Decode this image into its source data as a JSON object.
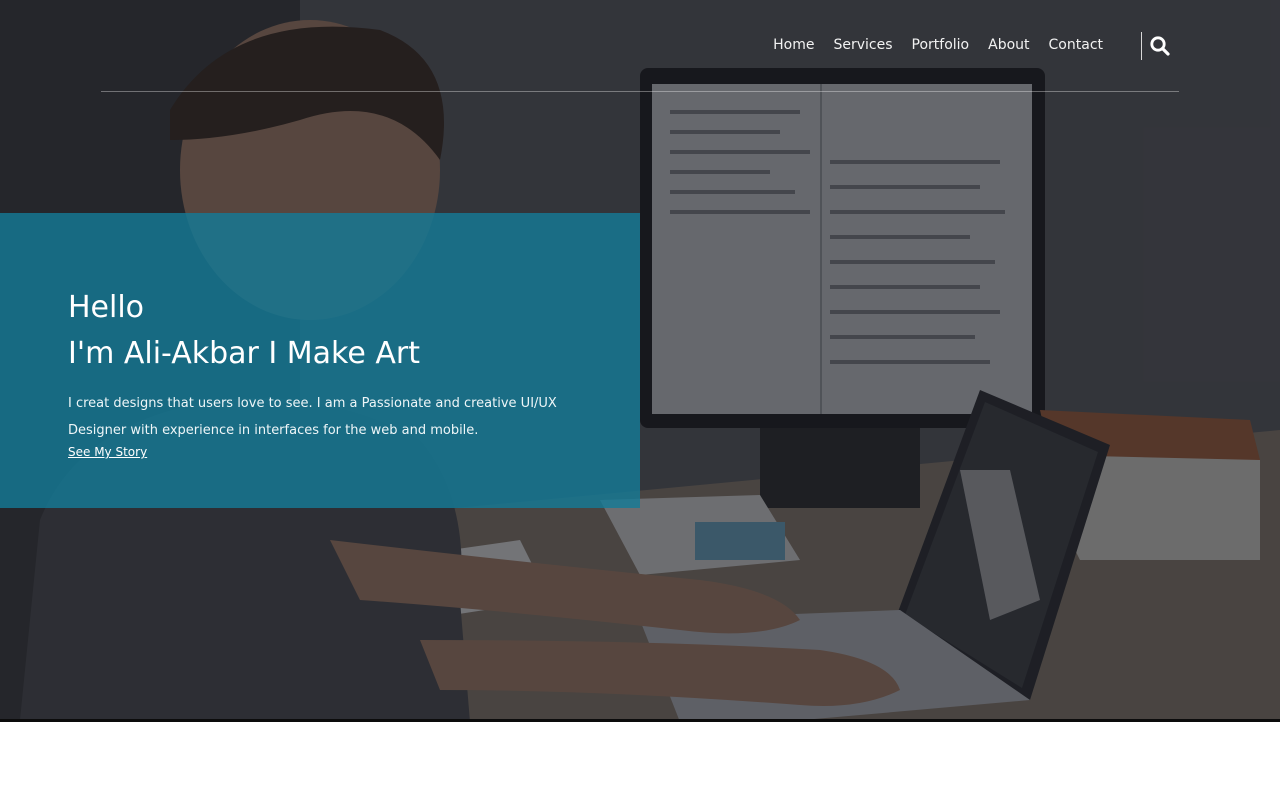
{
  "nav": {
    "items": [
      {
        "label": "Home"
      },
      {
        "label": "Services"
      },
      {
        "label": "Portfolio"
      },
      {
        "label": "About"
      },
      {
        "label": "Contact"
      }
    ],
    "search_icon": "search-icon"
  },
  "hero": {
    "greeting_line1": "Hello",
    "greeting_line2": "I'm Ali-Akbar I Make Art",
    "description": "I creat designs that users love to see. I am a Passionate and creative UI/UX Designer with experience in interfaces for the web and mobile.",
    "link_label": "See My Story",
    "background_image": "person-working-at-desk-with-computer-and-laptop"
  },
  "colors": {
    "card_accent": "#157a96",
    "page_background": "#ffffff"
  }
}
